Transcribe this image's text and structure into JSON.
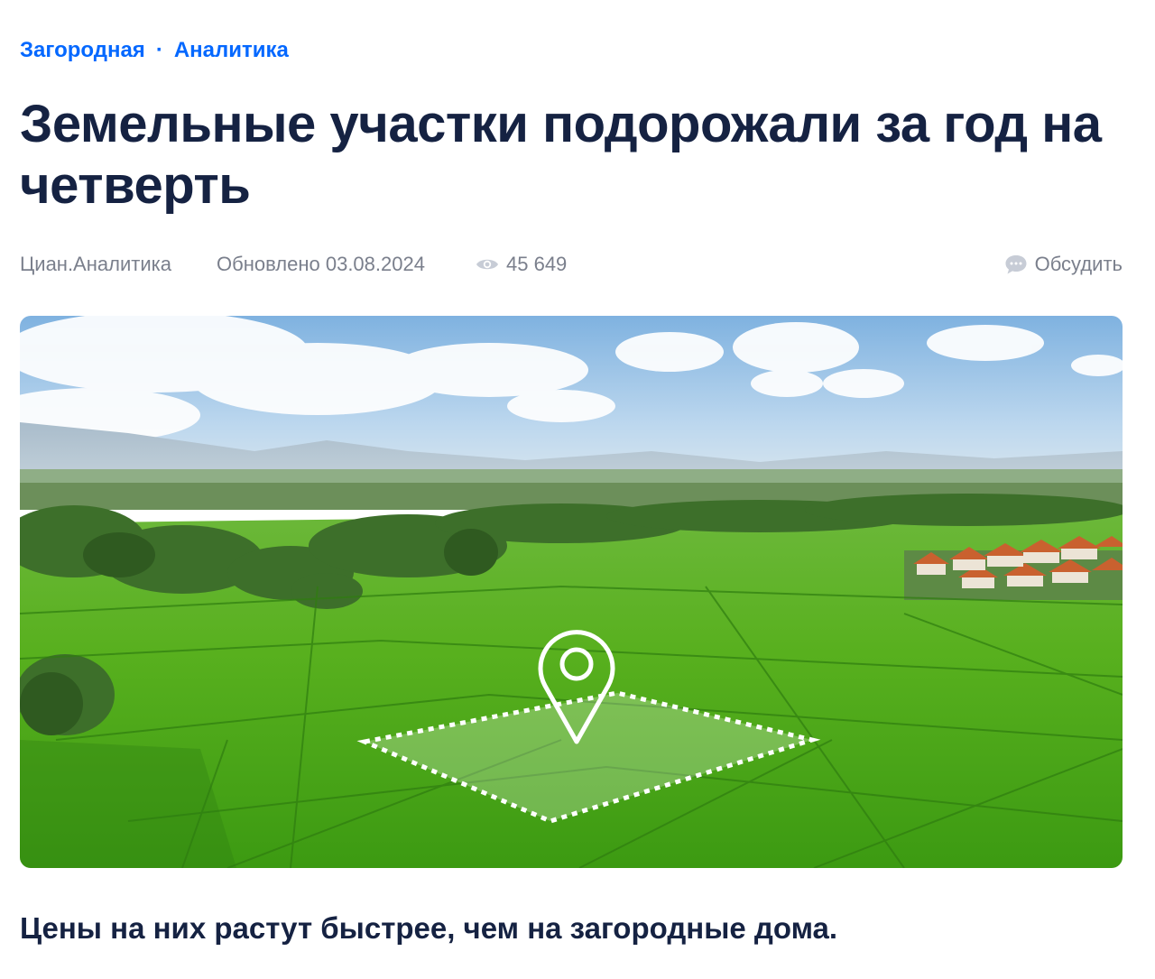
{
  "breadcrumbs": {
    "items": [
      "Загородная",
      "Аналитика"
    ],
    "separator": "·"
  },
  "article": {
    "title": "Земельные участки подорожали за год на четверть",
    "author": "Циан.Аналитика",
    "updated": "Обновлено 03.08.2024",
    "views": "45 649",
    "discuss_label": "Обсудить",
    "lead": "Цены на них растут быстрее, чем на загородные дома."
  },
  "colors": {
    "link": "#0468ff",
    "title": "#152242",
    "meta": "#7a7f8c"
  },
  "icons": {
    "views": "eye-icon",
    "discuss": "chat-bubble-icon",
    "hero_marker": "location-pin-icon"
  }
}
